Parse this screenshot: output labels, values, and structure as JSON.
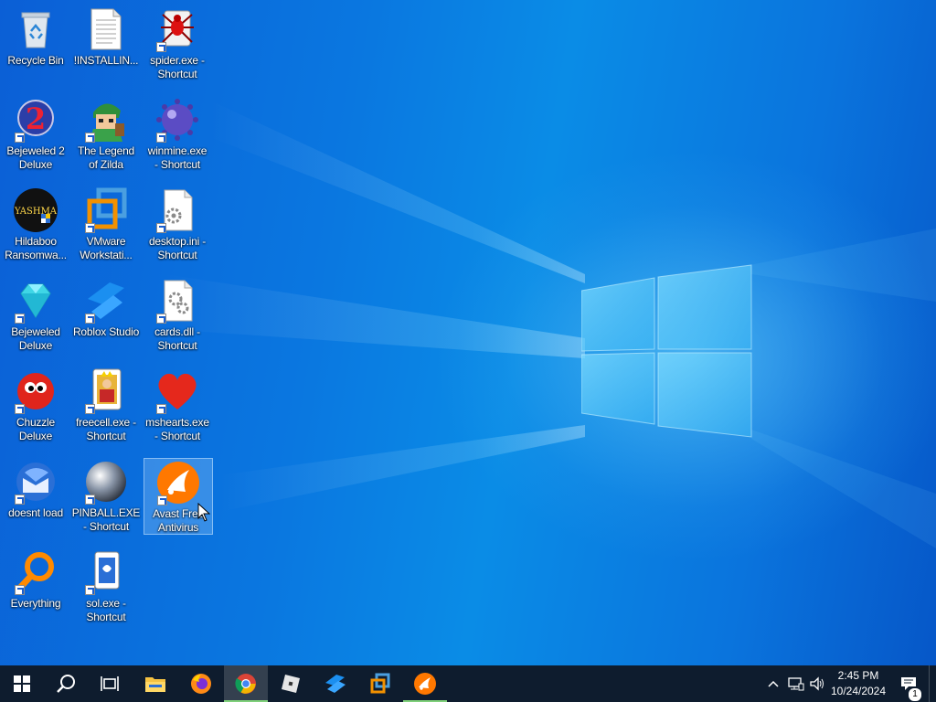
{
  "desktop_icons": [
    {
      "id": "recycle-bin",
      "label": "Recycle Bin",
      "shortcut": false
    },
    {
      "id": "installing",
      "label": "!INSTALLIN...",
      "shortcut": false
    },
    {
      "id": "spider",
      "label": "spider.exe -\nShortcut",
      "shortcut": true
    },
    {
      "id": "bejeweled2",
      "label": "Bejeweled 2\nDeluxe",
      "shortcut": true
    },
    {
      "id": "zilda",
      "label": "The Legend\nof Zilda",
      "shortcut": true
    },
    {
      "id": "winmine",
      "label": "winmine.exe\n- Shortcut",
      "shortcut": true
    },
    {
      "id": "hildaboo",
      "label": "Hildaboo\nRansomwa...",
      "shortcut": false
    },
    {
      "id": "vmware",
      "label": "VMware\nWorkstati...",
      "shortcut": true
    },
    {
      "id": "desktopini",
      "label": "desktop.ini -\nShortcut",
      "shortcut": true
    },
    {
      "id": "bejeweled",
      "label": "Bejeweled\nDeluxe",
      "shortcut": true
    },
    {
      "id": "roblox-studio",
      "label": "Roblox Studio",
      "shortcut": true
    },
    {
      "id": "cardsdll",
      "label": "cards.dll -\nShortcut",
      "shortcut": true
    },
    {
      "id": "chuzzle",
      "label": "Chuzzle\nDeluxe",
      "shortcut": true
    },
    {
      "id": "freecell",
      "label": "freecell.exe -\nShortcut",
      "shortcut": true
    },
    {
      "id": "mshearts",
      "label": "mshearts.exe\n- Shortcut",
      "shortcut": true
    },
    {
      "id": "doesnt-load",
      "label": "doesnt load",
      "shortcut": true
    },
    {
      "id": "pinball",
      "label": "PINBALL.EXE\n- Shortcut",
      "shortcut": true
    },
    {
      "id": "avast",
      "label": "Avast Free\nAntivirus",
      "shortcut": true,
      "selected": true
    },
    {
      "id": "everything",
      "label": "Everything",
      "shortcut": true
    },
    {
      "id": "sol",
      "label": "sol.exe -\nShortcut",
      "shortcut": true
    }
  ],
  "taskbar": {
    "background": "#0e1c2e",
    "buttons": [
      {
        "id": "start",
        "icon": "windows-logo-icon"
      },
      {
        "id": "search",
        "icon": "search-icon"
      },
      {
        "id": "task-view",
        "icon": "task-view-icon"
      },
      {
        "id": "file-explorer",
        "icon": "folder-icon"
      },
      {
        "id": "firefox",
        "icon": "firefox-icon"
      },
      {
        "id": "chrome",
        "icon": "chrome-icon",
        "active": true,
        "running": true
      },
      {
        "id": "roblox",
        "icon": "roblox-icon"
      },
      {
        "id": "roblox-studio",
        "icon": "roblox-studio-icon"
      },
      {
        "id": "vmware",
        "icon": "vmware-icon"
      },
      {
        "id": "avast",
        "icon": "avast-icon",
        "running": true
      }
    ],
    "tray": {
      "time": "2:45 PM",
      "date": "10/24/2024",
      "notification_count": "1"
    }
  }
}
